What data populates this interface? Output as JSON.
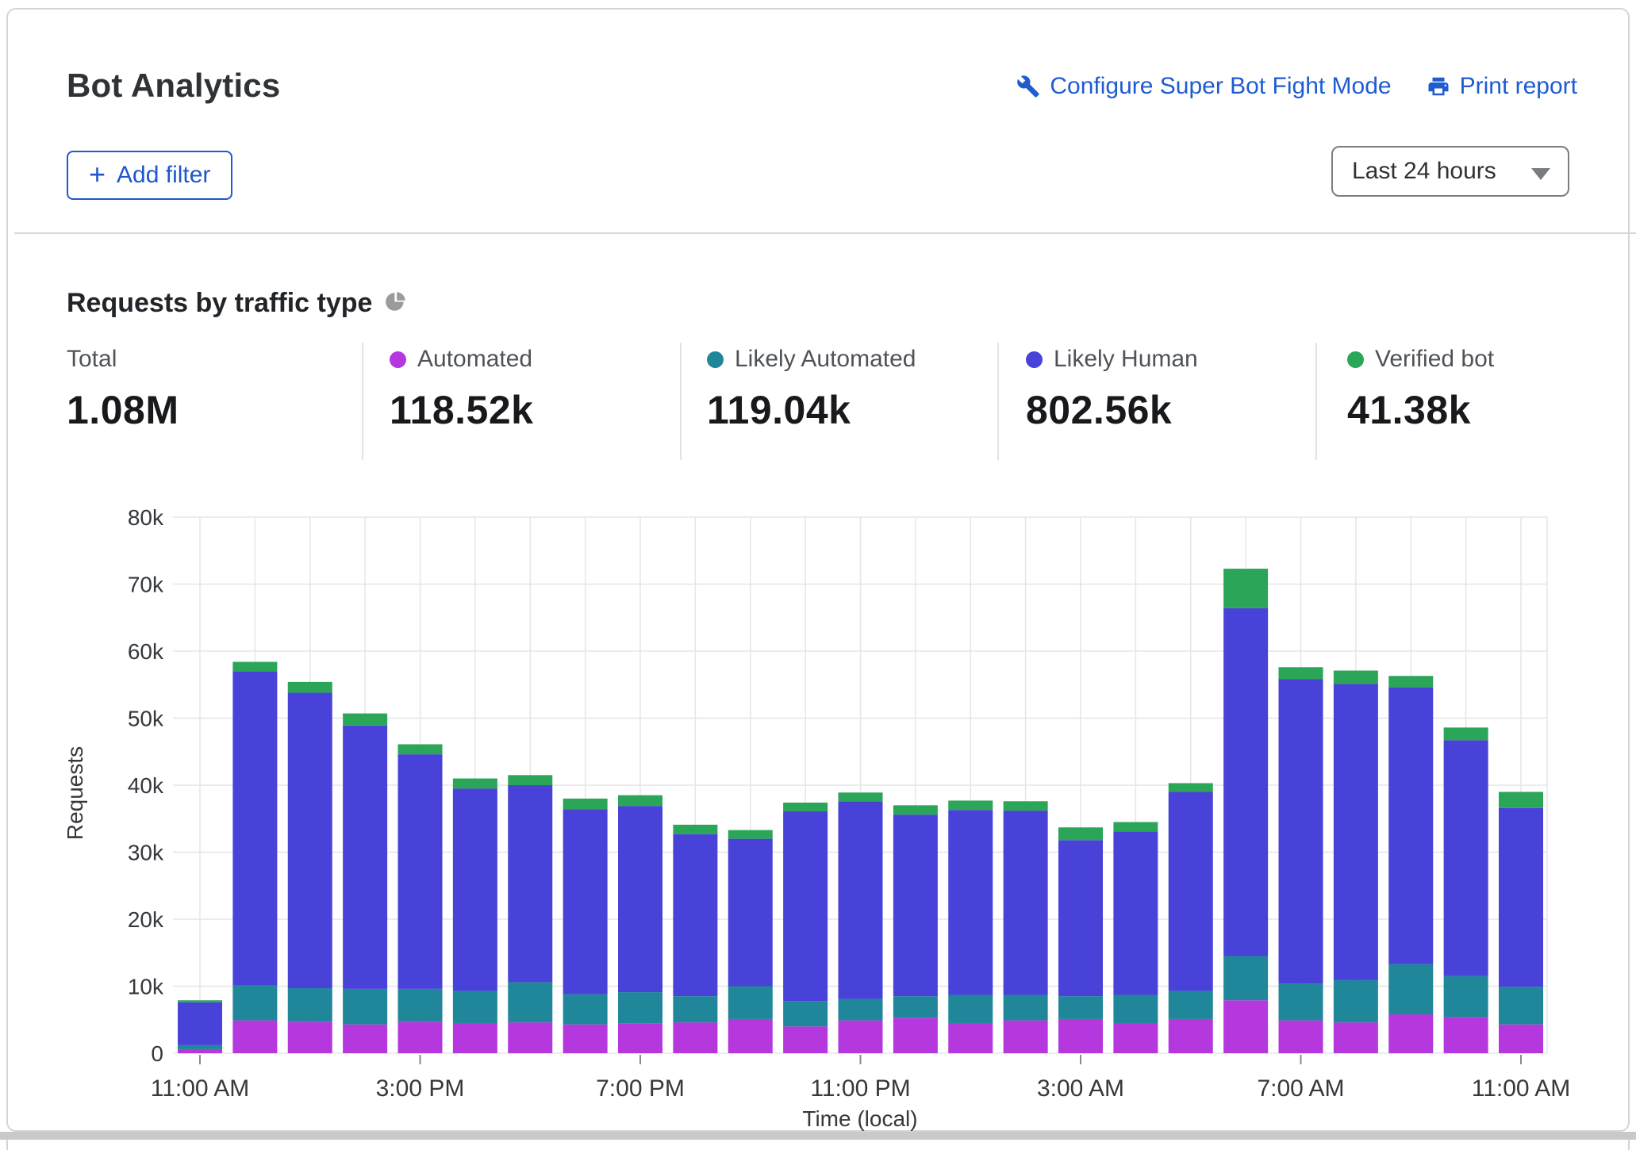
{
  "header": {
    "title": "Bot Analytics",
    "configure_link": "Configure Super Bot Fight Mode",
    "print_link": "Print report",
    "add_filter_label": "Add filter",
    "plus": "+",
    "time_range_selected": "Last 24 hours"
  },
  "section": {
    "heading": "Requests by traffic type"
  },
  "stats": [
    {
      "label": "Total",
      "value": "1.08M",
      "color": null
    },
    {
      "label": "Automated",
      "value": "118.52k",
      "color": "#B438DE"
    },
    {
      "label": "Likely Automated",
      "value": "119.04k",
      "color": "#1F8799"
    },
    {
      "label": "Likely Human",
      "value": "802.56k",
      "color": "#4842D9"
    },
    {
      "label": "Verified bot",
      "value": "41.38k",
      "color": "#2BA558"
    }
  ],
  "colors": {
    "link_blue": "#1e5cd0",
    "grid": "#e6e6e6",
    "axis_text": "#35383d",
    "card_border": "#d5d5d5"
  },
  "chart_data": {
    "type": "bar",
    "stacked": true,
    "title": "Requests by traffic type",
    "xlabel": "Time (local)",
    "ylabel": "Requests",
    "ylim": [
      0,
      80000
    ],
    "grid": true,
    "ytick_labels": [
      "0",
      "10k",
      "20k",
      "30k",
      "40k",
      "50k",
      "60k",
      "70k",
      "80k"
    ],
    "xtick_indices": [
      0,
      4,
      8,
      12,
      16,
      20,
      24
    ],
    "xtick_labels": [
      "11:00 AM",
      "3:00 PM",
      "7:00 PM",
      "11:00 PM",
      "3:00 AM",
      "7:00 AM",
      "11:00 AM"
    ],
    "categories": [
      "11:00 AM",
      "12:00 PM",
      "1:00 PM",
      "2:00 PM",
      "3:00 PM",
      "4:00 PM",
      "5:00 PM",
      "6:00 PM",
      "7:00 PM",
      "8:00 PM",
      "9:00 PM",
      "10:00 PM",
      "11:00 PM",
      "12:00 AM",
      "1:00 AM",
      "2:00 AM",
      "3:00 AM",
      "4:00 AM",
      "5:00 AM",
      "6:00 AM",
      "7:00 AM",
      "8:00 AM",
      "9:00 AM",
      "10:00 AM",
      "11:00 AM"
    ],
    "series": [
      {
        "name": "Automated",
        "color": "#B438DE",
        "values": [
          600,
          4900,
          4700,
          4300,
          4700,
          4500,
          4600,
          4300,
          4400,
          4600,
          5100,
          4000,
          4900,
          5300,
          4500,
          4900,
          5100,
          4500,
          5100,
          7900,
          4900,
          4600,
          5800,
          5400,
          4300
        ]
      },
      {
        "name": "Likely Automated",
        "color": "#1F8799",
        "values": [
          600,
          5200,
          5000,
          5300,
          4900,
          4800,
          6000,
          4500,
          4700,
          3900,
          4900,
          3800,
          3200,
          3200,
          4200,
          3800,
          3400,
          4200,
          4200,
          6600,
          5500,
          6300,
          7500,
          6100,
          5600
        ]
      },
      {
        "name": "Likely Human",
        "color": "#4842D9",
        "values": [
          6400,
          46900,
          44100,
          39300,
          35000,
          30200,
          29400,
          27600,
          27800,
          24200,
          22000,
          28300,
          29500,
          27100,
          27600,
          27500,
          23300,
          24400,
          29700,
          51900,
          45400,
          44200,
          41300,
          35200,
          26700
        ]
      },
      {
        "name": "Verified bot",
        "color": "#2BA558",
        "values": [
          300,
          1400,
          1600,
          1800,
          1500,
          1500,
          1500,
          1600,
          1600,
          1400,
          1300,
          1300,
          1300,
          1400,
          1400,
          1400,
          1900,
          1400,
          1300,
          5900,
          1800,
          2000,
          1700,
          1900,
          2400
        ]
      }
    ]
  }
}
